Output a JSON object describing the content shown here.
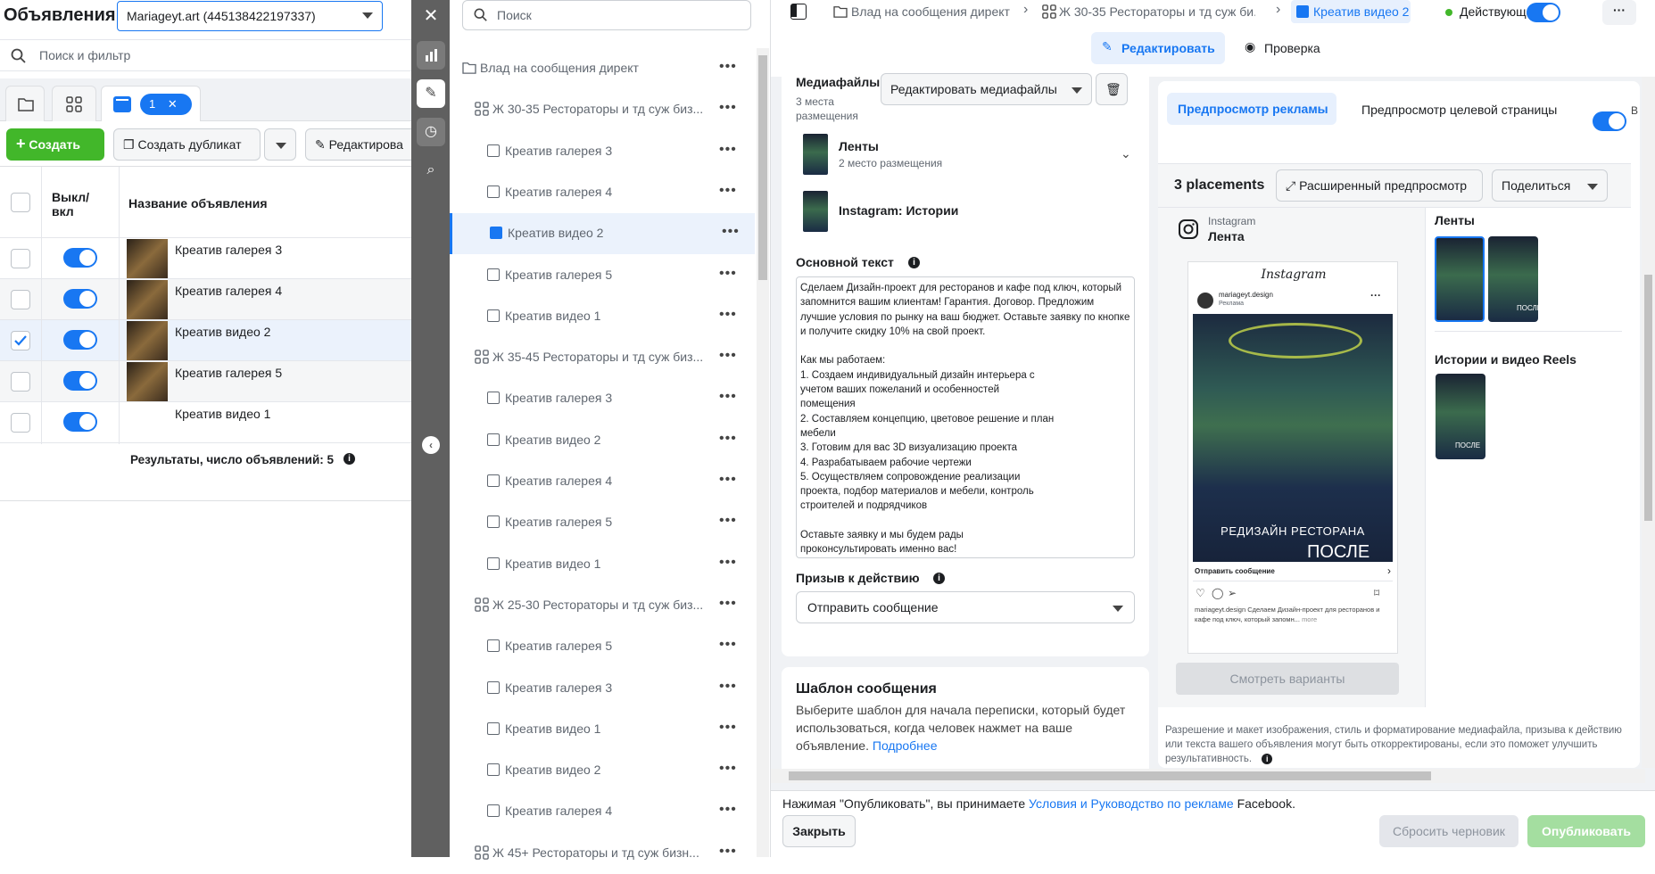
{
  "left": {
    "title": "Объявления",
    "account_select": "Mariageyt.art (445138422197337)",
    "search_placeholder": "Поиск и фильтр",
    "selected_pill": "1",
    "create_label": "Создать",
    "duplicate_label": "Создать дубликат",
    "edit_label": "Редактирова",
    "col_toggle": "Выкл/\nвкл",
    "col_name": "Название объявления",
    "rows": [
      {
        "name": "Креатив галерея 3",
        "checked": false,
        "has_thumb": true
      },
      {
        "name": "Креатив галерея 4",
        "checked": false,
        "has_thumb": true
      },
      {
        "name": "Креатив видео 2",
        "checked": true,
        "has_thumb": true
      },
      {
        "name": "Креатив галерея 5",
        "checked": false,
        "has_thumb": true
      },
      {
        "name": "Креатив видео 1",
        "checked": false,
        "has_thumb": false
      }
    ],
    "results_label": "Результаты, число объявлений: 5"
  },
  "tree": {
    "search_placeholder": "Поиск",
    "items": [
      {
        "label": "Влад на сообщения директ",
        "level": 0,
        "type": "campaign"
      },
      {
        "label": "Ж 30-35 Рестораторы и тд суж биз...",
        "level": 1,
        "type": "adset"
      },
      {
        "label": "Креатив галерея 3",
        "level": 2,
        "type": "ad"
      },
      {
        "label": "Креатив галерея 4",
        "level": 2,
        "type": "ad"
      },
      {
        "label": "Креатив видео 2",
        "level": 2,
        "type": "ad",
        "selected": true
      },
      {
        "label": "Креатив галерея 5",
        "level": 2,
        "type": "ad"
      },
      {
        "label": "Креатив видео 1",
        "level": 2,
        "type": "ad"
      },
      {
        "label": "Ж 35-45 Рестораторы и тд суж биз...",
        "level": 1,
        "type": "adset"
      },
      {
        "label": "Креатив галерея 3",
        "level": 2,
        "type": "ad"
      },
      {
        "label": "Креатив видео 2",
        "level": 2,
        "type": "ad"
      },
      {
        "label": "Креатив галерея 4",
        "level": 2,
        "type": "ad"
      },
      {
        "label": "Креатив галерея 5",
        "level": 2,
        "type": "ad"
      },
      {
        "label": "Креатив видео 1",
        "level": 2,
        "type": "ad"
      },
      {
        "label": "Ж 25-30 Рестораторы и тд суж биз...",
        "level": 1,
        "type": "adset"
      },
      {
        "label": "Креатив галерея 5",
        "level": 2,
        "type": "ad"
      },
      {
        "label": "Креатив галерея 3",
        "level": 2,
        "type": "ad"
      },
      {
        "label": "Креатив видео 1",
        "level": 2,
        "type": "ad"
      },
      {
        "label": "Креатив видео 2",
        "level": 2,
        "type": "ad"
      },
      {
        "label": "Креатив галерея 4",
        "level": 2,
        "type": "ad"
      },
      {
        "label": "Ж 45+ Рестораторы и тд суж бизн...",
        "level": 1,
        "type": "adset"
      }
    ]
  },
  "editor": {
    "breadcrumbs": [
      "Влад на сообщения директ",
      "Ж 30-35 Рестораторы и тд суж би...",
      "Креатив видео 2"
    ],
    "status": "Действующая",
    "edit_tab": "Редактировать",
    "review_tab": "Проверка",
    "media_title": "Медиафайлы",
    "media_sub": "3 места размещения",
    "edit_media_btn": "Редактировать медиафайлы",
    "placement_feeds": "Ленты",
    "placement_feeds_sub": "2 место размещения",
    "placement_stories": "Instagram: Истории",
    "primary_text_label": "Основной текст",
    "primary_text": "Сделаем Дизайн-проект для ресторанов и кафе под ключ, который запомнится вашим клиентам! Гарантия. Договор. Предложим лучшие условия по рынку на ваш бюджет. Оставьте заявку по кнопке и получите скидку 10% на свой проект.\n\nКак мы работаем:\n1. Создаем индивидуальный дизайн интерьера с\nучетом ваших пожеланий и особенностей\nпомещения\n2. Составляем концепцию, цветовое решение и план\nмебели\n3. Готовим для вас 3D визуализацию проекта\n4. Разрабатываем рабочие чертежи\n5. Осуществляем сопровождение реализации\nпроекта, подбор материалов и мебели, контроль\nстроителей и подрядчиков\n\nОставьте заявку и мы будем рады\nпроконсультировать именно вас!",
    "cta_label": "Призыв к действию",
    "cta_value": "Отправить сообщение",
    "template_title": "Шаблон сообщения",
    "template_text": "Выберите шаблон для начала переписки, который будет использоваться, когда человек нажмет на ваше объявление.",
    "template_link": "Подробнее"
  },
  "preview": {
    "tab_ad": "Предпросмотр рекламы",
    "tab_landing": "Предпросмотр целевой страницы",
    "toggle_trailing": "В",
    "placements_count": "3 placements",
    "expanded_btn": "Расширенный предпросмотр",
    "share_btn": "Поделиться",
    "platform": "Instagram",
    "platform_place": "Лента",
    "ig_logo": "Instagram",
    "ig_account": "mariageyt.design",
    "ig_sponsored": "Реклама",
    "img_caption_1": "РЕДИЗАЙН РЕСТОРАНА",
    "img_caption_2": "ПОСЛЕ",
    "ig_cta": "Отправить сообщение",
    "ig_caption_account": "mariageyt.design",
    "ig_caption": "Сделаем Дизайн-проект для ресторанов и кафе под ключ, который запомн...",
    "ig_more": "more",
    "variants_btn": "Смотреть варианты",
    "side_feeds": "Ленты",
    "side_stories": "Истории и видео Reels",
    "mini_caption": "ПОСЛЕ",
    "disclaimer": "Разрешение и макет изображения, стиль и форматирование медиафайла, призыва к действию или текста вашего объявления могут быть откорректированы, если это поможет улучшить результативность."
  },
  "footer": {
    "notice_prefix": "Нажимая \"Опубликовать\", вы принимаете ",
    "notice_link": "Условия и Руководство по рекламе",
    "notice_suffix": " Facebook.",
    "close_btn": "Закрыть",
    "reset_btn": "Сбросить черновик",
    "publish_btn": "Опубликовать"
  },
  "colors": {
    "accent": "#1877f2",
    "green": "#42b72a",
    "sidebar": "#606060"
  }
}
